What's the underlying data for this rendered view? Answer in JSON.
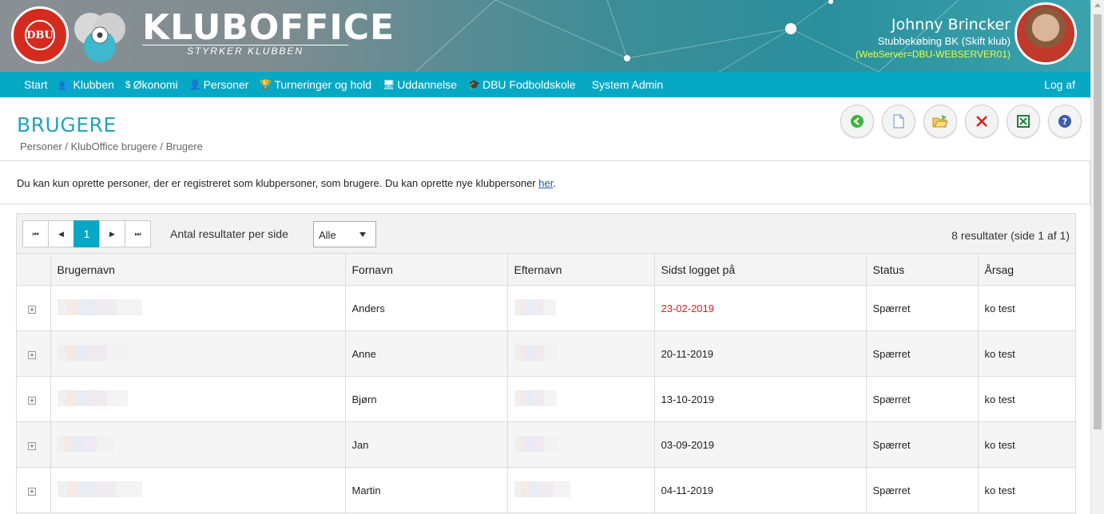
{
  "header": {
    "dbu_logo_text": "DBU",
    "dbu_logo_ring": "DANSK BOLDSPIL-UNION 1889",
    "brand_name": "KLUBOFFICE",
    "brand_tagline": "STYRKER KLUBBEN",
    "user_name": "Johnny Brincker",
    "club": "Stubbekøbing BK (Skift klub)",
    "server": "(WebServer=DBU-WEBSERVER01)"
  },
  "nav": {
    "items": [
      {
        "label": "Start",
        "icon": ""
      },
      {
        "label": "Klubben",
        "icon": "people-icon"
      },
      {
        "label": "Økonomi",
        "icon": "coin-icon"
      },
      {
        "label": "Personer",
        "icon": "person-icon"
      },
      {
        "label": "Turneringer og hold",
        "icon": "trophy-icon"
      },
      {
        "label": "Uddannelse",
        "icon": "screen-icon"
      },
      {
        "label": "DBU Fodboldskole",
        "icon": "graduation-cap-icon"
      },
      {
        "label": "System Admin",
        "icon": ""
      }
    ],
    "logout": "Log af"
  },
  "page": {
    "title": "BRUGERE",
    "breadcrumb": "Personer / KlubOffice brugere / Brugere",
    "info_text": "Du kan kun oprette personer, der er registreret som klubpersoner, som brugere. Du kan oprette nye klubpersoner ",
    "info_link": "her",
    "info_end": "."
  },
  "toolbar": [
    "back-icon",
    "new-document-icon",
    "open-folder-icon",
    "delete-icon",
    "excel-icon",
    "help-icon"
  ],
  "pager": {
    "current_page": "1",
    "per_page_label": "Antal resultater per side",
    "per_page_value": "Alle",
    "results_text": "8 resultater (side 1 af 1)"
  },
  "table": {
    "columns": [
      "",
      "Brugernavn",
      "Fornavn",
      "Efternavn",
      "Sidst logget på",
      "Status",
      "Årsag"
    ],
    "rows": [
      {
        "fornavn": "Anders",
        "sidst": "23-02-2019",
        "status": "Spærret",
        "aarsag": "ko test"
      },
      {
        "fornavn": "Anne",
        "sidst": "20-11-2019",
        "status": "Spærret",
        "aarsag": "ko test"
      },
      {
        "fornavn": "Bjørn",
        "sidst": "13-10-2019",
        "status": "Spærret",
        "aarsag": "ko test"
      },
      {
        "fornavn": "Jan",
        "sidst": "03-09-2019",
        "status": "Spærret",
        "aarsag": "ko test"
      },
      {
        "fornavn": "Martin",
        "sidst": "04-11-2019",
        "status": "Spærret",
        "aarsag": "ko test"
      }
    ]
  },
  "colors": {
    "accent": "#06a8c4",
    "title": "#23a3bd",
    "expired_date": "#d42020",
    "server_text": "#e9ff3a"
  }
}
